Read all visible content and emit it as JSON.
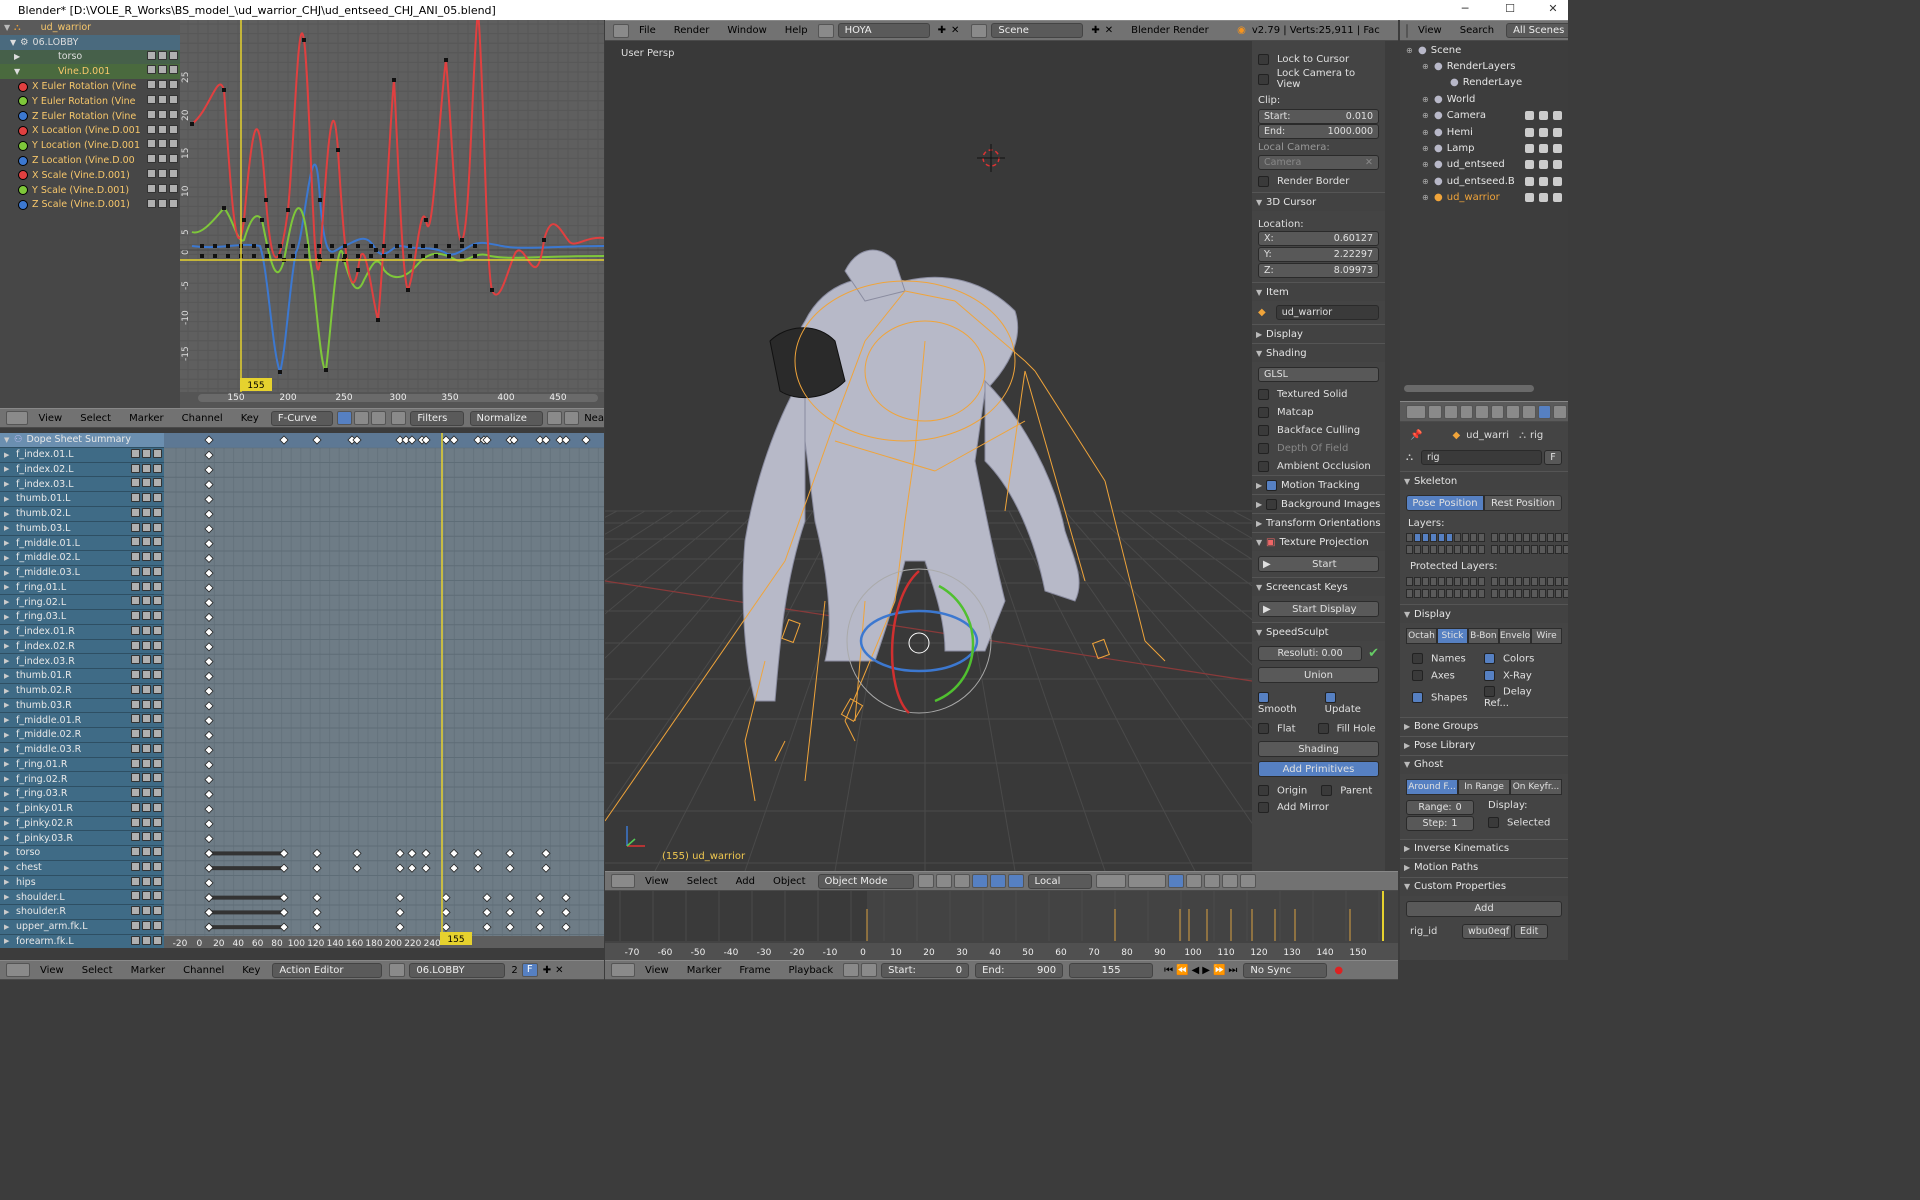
{
  "window": {
    "title": "Blender* [D:\\VOLE_R_Works\\BS_model_\\ud_warrior_CHJ\\ud_entseed_CHJ_ANI_05.blend]",
    "min_icon": "minimize-icon",
    "max_icon": "maximize-icon",
    "close_icon": "close-icon"
  },
  "colors": {
    "x_channel": "#e04040",
    "y_channel": "#7ec73a",
    "z_channel": "#3c78d0",
    "frame_line": "#e6d22e",
    "selection": "#f0a43a",
    "accent": "#5680c2"
  },
  "info_header": {
    "menus": [
      "File",
      "Render",
      "Window",
      "Help"
    ],
    "screen": "HOYA",
    "scene": "Scene",
    "engine": "Blender Render",
    "stats": "v2.79 | Verts:25,911 | Fac"
  },
  "graph_editor": {
    "channels": {
      "rig": "ud_warrior",
      "action": "06.LOBBY",
      "groups": [
        "torso",
        "Vine.D.001"
      ],
      "curves": [
        {
          "label": "X Euler Rotation (Vine",
          "color": "#e04040"
        },
        {
          "label": "Y Euler Rotation (Vine",
          "color": "#7ec73a"
        },
        {
          "label": "Z Euler Rotation (Vine",
          "color": "#3c78d0"
        },
        {
          "label": "X Location (Vine.D.001",
          "color": "#e04040"
        },
        {
          "label": "Y Location (Vine.D.001",
          "color": "#7ec73a"
        },
        {
          "label": "Z Location (Vine.D.00",
          "color": "#3c78d0"
        },
        {
          "label": "X Scale (Vine.D.001)",
          "color": "#e04040"
        },
        {
          "label": "Y Scale (Vine.D.001)",
          "color": "#7ec73a"
        },
        {
          "label": "Z Scale (Vine.D.001)",
          "color": "#3c78d0"
        }
      ]
    },
    "y_ticks": [
      "25",
      "20",
      "15",
      "10",
      "5",
      "0",
      "-5",
      "-10",
      "-15"
    ],
    "x_ticks": [
      "150",
      "200",
      "250",
      "300",
      "350",
      "400",
      "450"
    ],
    "current_frame": "155",
    "header": {
      "menus": [
        "View",
        "Select",
        "Marker",
        "Channel",
        "Key"
      ],
      "mode": "F-Curve",
      "filters": "Filters",
      "normalize": "Normalize",
      "near": "Nea"
    }
  },
  "dope_sheet": {
    "summary": "Dope Sheet Summary",
    "channels": [
      "f_index.01.L",
      "f_index.02.L",
      "f_index.03.L",
      "thumb.01.L",
      "thumb.02.L",
      "thumb.03.L",
      "f_middle.01.L",
      "f_middle.02.L",
      "f_middle.03.L",
      "f_ring.01.L",
      "f_ring.02.L",
      "f_ring.03.L",
      "f_index.01.R",
      "f_index.02.R",
      "f_index.03.R",
      "thumb.01.R",
      "thumb.02.R",
      "thumb.03.R",
      "f_middle.01.R",
      "f_middle.02.R",
      "f_middle.03.R",
      "f_ring.01.R",
      "f_ring.02.R",
      "f_ring.03.R",
      "f_pinky.01.R",
      "f_pinky.02.R",
      "f_pinky.03.R",
      "torso",
      "chest",
      "hips",
      "shoulder.L",
      "shoulder.R",
      "upper_arm.fk.L",
      "forearm.fk.L"
    ],
    "x_ticks": [
      "-20",
      "0",
      "20",
      "40",
      "60",
      "80",
      "100",
      "120",
      "140",
      "160",
      "180",
      "200",
      "220",
      "240"
    ],
    "current_frame": "155",
    "header": {
      "menus": [
        "View",
        "Select",
        "Marker",
        "Channel",
        "Key"
      ],
      "mode": "Action Editor",
      "action": "06.LOBBY",
      "users": "2",
      "fake_user": "F"
    }
  },
  "viewport": {
    "label": "User Persp",
    "object_info": "(155) ud_warrior",
    "header": {
      "menus": [
        "View",
        "Select",
        "Add",
        "Object"
      ],
      "mode": "Object Mode",
      "orientation": "Local"
    }
  },
  "properties_panel": {
    "lock_to_cursor": "Lock to Cursor",
    "lock_camera": "Lock Camera to View",
    "clip": "Clip:",
    "clip_start_label": "Start:",
    "clip_start": "0.010",
    "clip_end_label": "End:",
    "clip_end": "1000.000",
    "local_camera": "Local Camera:",
    "camera": "Camera",
    "render_border": "Render Border",
    "cursor_title": "3D Cursor",
    "location": "Location:",
    "x_label": "X:",
    "x": "0.60127",
    "y_label": "Y:",
    "y": "2.22297",
    "z_label": "Z:",
    "z": "8.09973",
    "item_title": "Item",
    "item_name": "ud_warrior",
    "display": "Display",
    "shading": "Shading",
    "shading_mode": "GLSL",
    "shading_opts": [
      "Textured Solid",
      "Matcap",
      "Backface Culling",
      "Depth Of Field",
      "Ambient Occlusion"
    ],
    "motion_tracking": "Motion Tracking",
    "background_images": "Background Images",
    "transform_orientations": "Transform Orientations",
    "texture_projection": "Texture Projection",
    "start": "Start",
    "screencast": "Screencast Keys",
    "start_display": "Start Display",
    "speedsculpt": "SpeedSculpt",
    "resolution_label": "Resoluti:",
    "resolution": "0.00",
    "union": "Union",
    "smooth": "Smooth",
    "update": "Update",
    "flat": "Flat",
    "fill_hole": "Fill Hole",
    "shading2": "Shading",
    "add_primitives": "Add Primitives",
    "origin": "Origin",
    "parent": "Parent",
    "add_mirror": "Add Mirror"
  },
  "outliner": {
    "header": {
      "menus": [
        "View",
        "Search"
      ],
      "filter": "All Scenes"
    },
    "items": [
      {
        "label": "Scene",
        "depth": 0
      },
      {
        "label": "RenderLayers",
        "depth": 1
      },
      {
        "label": "RenderLaye",
        "depth": 2
      },
      {
        "label": "World",
        "depth": 1
      },
      {
        "label": "Camera",
        "depth": 1
      },
      {
        "label": "Hemi",
        "depth": 1
      },
      {
        "label": "Lamp",
        "depth": 1
      },
      {
        "label": "ud_entseed",
        "depth": 1
      },
      {
        "label": "ud_entseed.B",
        "depth": 1
      },
      {
        "label": "ud_warrior",
        "depth": 1
      }
    ]
  },
  "armature_props": {
    "object": "ud_warri",
    "data": "rig",
    "datablock": "rig",
    "fake": "F",
    "skeleton": "Skeleton",
    "pose_position": "Pose Position",
    "rest_position": "Rest Position",
    "layers": "Layers:",
    "protected_layers": "Protected Layers:",
    "display": "Display",
    "display_modes": [
      "Octah",
      "Stick",
      "B-Bon",
      "Envelo",
      "Wire"
    ],
    "names": "Names",
    "colors": "Colors",
    "axes": "Axes",
    "xray": "X-Ray",
    "shapes": "Shapes",
    "delay_refresh": "Delay Ref...",
    "bone_groups": "Bone Groups",
    "pose_library": "Pose Library",
    "ghost": "Ghost",
    "ghost_modes": [
      "Around F...",
      "In Range",
      "On Keyfr..."
    ],
    "range_label": "Range:",
    "range": "0",
    "step_label": "Step:",
    "step": "1",
    "display_label": "Display:",
    "selected": "Selected",
    "inverse_kinematics": "Inverse Kinematics",
    "motion_paths": "Motion Paths",
    "custom_properties": "Custom Properties",
    "add": "Add",
    "prop_name": "rig_id",
    "prop_value": "wbu0eqf",
    "edit": "Edit"
  },
  "timeline": {
    "x_ticks": [
      "-70",
      "-60",
      "-50",
      "-40",
      "-30",
      "-20",
      "-10",
      "0",
      "10",
      "20",
      "30",
      "40",
      "50",
      "60",
      "70",
      "80",
      "90",
      "100",
      "110",
      "120",
      "130",
      "140",
      "150"
    ],
    "header": {
      "menus": [
        "View",
        "Marker",
        "Frame",
        "Playback"
      ],
      "start_label": "Start:",
      "start": "0",
      "end_label": "End:",
      "end": "900",
      "frame": "155",
      "sync": "No Sync"
    }
  }
}
